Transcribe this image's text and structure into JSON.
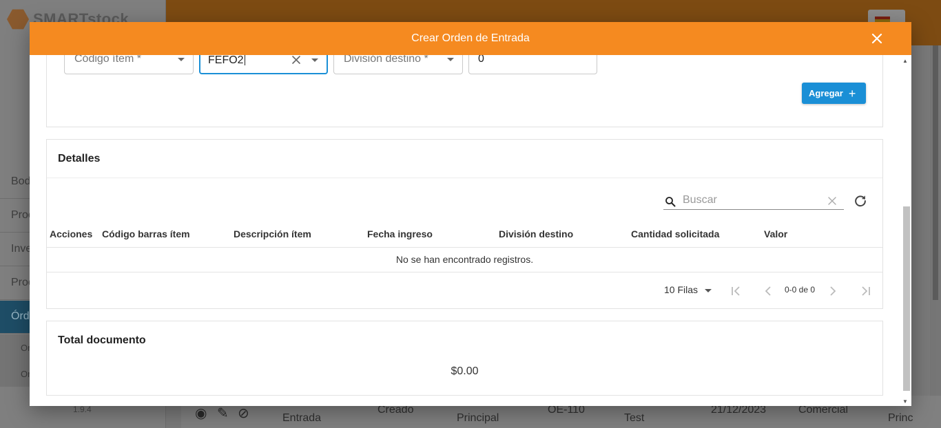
{
  "background": {
    "logo_text": "SMARTstock",
    "menu_items": [
      "Bod",
      "Proc",
      "Inve",
      "Proc",
      "Órd"
    ],
    "sub_items": [
      "Or",
      "Or"
    ],
    "version": "1.9.4",
    "row": {
      "col1": "Entrada",
      "col2": "Creado",
      "col3": "Principal",
      "col4": "OE-110",
      "col5": "Test",
      "col6": "21/12/2023",
      "col7": "Comercial",
      "col8": "Princ"
    }
  },
  "modal": {
    "title": "Crear Orden de Entrada",
    "form": {
      "item_code_label": "Código ítem *",
      "lot_value": "FEFO2",
      "division_label": "División destino *",
      "quantity_value": "0",
      "add_button_label": "Agregar"
    },
    "details": {
      "title": "Detalles",
      "search_placeholder": "Buscar",
      "columns": [
        "Acciones",
        "Código barras ítem",
        "Descripción ítem",
        "Fecha ingreso",
        "División destino",
        "Cantidad solicitada",
        "Valor"
      ],
      "empty_message": "No se han encontrado registros.",
      "rows_per_page": "10 Filas",
      "page_info": "0-0 de 0"
    },
    "total": {
      "title": "Total documento",
      "value": "$0.00"
    }
  },
  "colors": {
    "modal_header": "#f58a20",
    "primary_button": "#1a8fd6"
  },
  "icons": [
    "close-icon",
    "clear-icon",
    "caret-down-icon",
    "plus-icon",
    "search-icon",
    "refresh-icon",
    "first-page-icon",
    "prev-page-icon",
    "next-page-icon",
    "last-page-icon"
  ]
}
